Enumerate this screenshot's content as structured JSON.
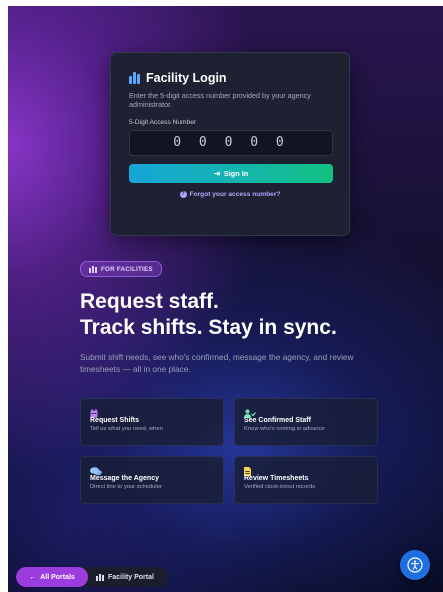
{
  "login": {
    "title": "Facility Login",
    "description": "Enter the 5-digit access number provided by your agency administrator.",
    "field_label": "5-Digit Access Number",
    "placeholder": "0 0 0 0 0",
    "sign_in_label": "Sign In",
    "forgot_label": "Forgot your access number?"
  },
  "hero": {
    "badge": "FOR FACILITIES",
    "headline_line1": "Request staff.",
    "headline_line2": "Track shifts. Stay in sync.",
    "subtext": "Submit shift needs, see who's confirmed, message the agency, and review timesheets — all in one place."
  },
  "features": [
    {
      "icon": "calendar-icon",
      "title": "Request Shifts",
      "desc": "Tell us what you need, when",
      "color": "#c084fc"
    },
    {
      "icon": "user-check-icon",
      "title": "See Confirmed Staff",
      "desc": "Know who's coming in advance",
      "color": "#6ee7b7"
    },
    {
      "icon": "chat-icon",
      "title": "Message the Agency",
      "desc": "Direct line to your scheduler",
      "color": "#93c5fd"
    },
    {
      "icon": "document-icon",
      "title": "Review Timesheets",
      "desc": "Verified clock-in/out records",
      "color": "#fcd34d"
    }
  ],
  "footer": {
    "all_portals": "All Portals",
    "facility_portal": "Facility Portal"
  },
  "colors": {
    "accent_purple": "#9b3dde",
    "signin_gradient_start": "#16a6d8",
    "signin_gradient_end": "#12c181",
    "accessibility_button": "#1f6fe0"
  }
}
